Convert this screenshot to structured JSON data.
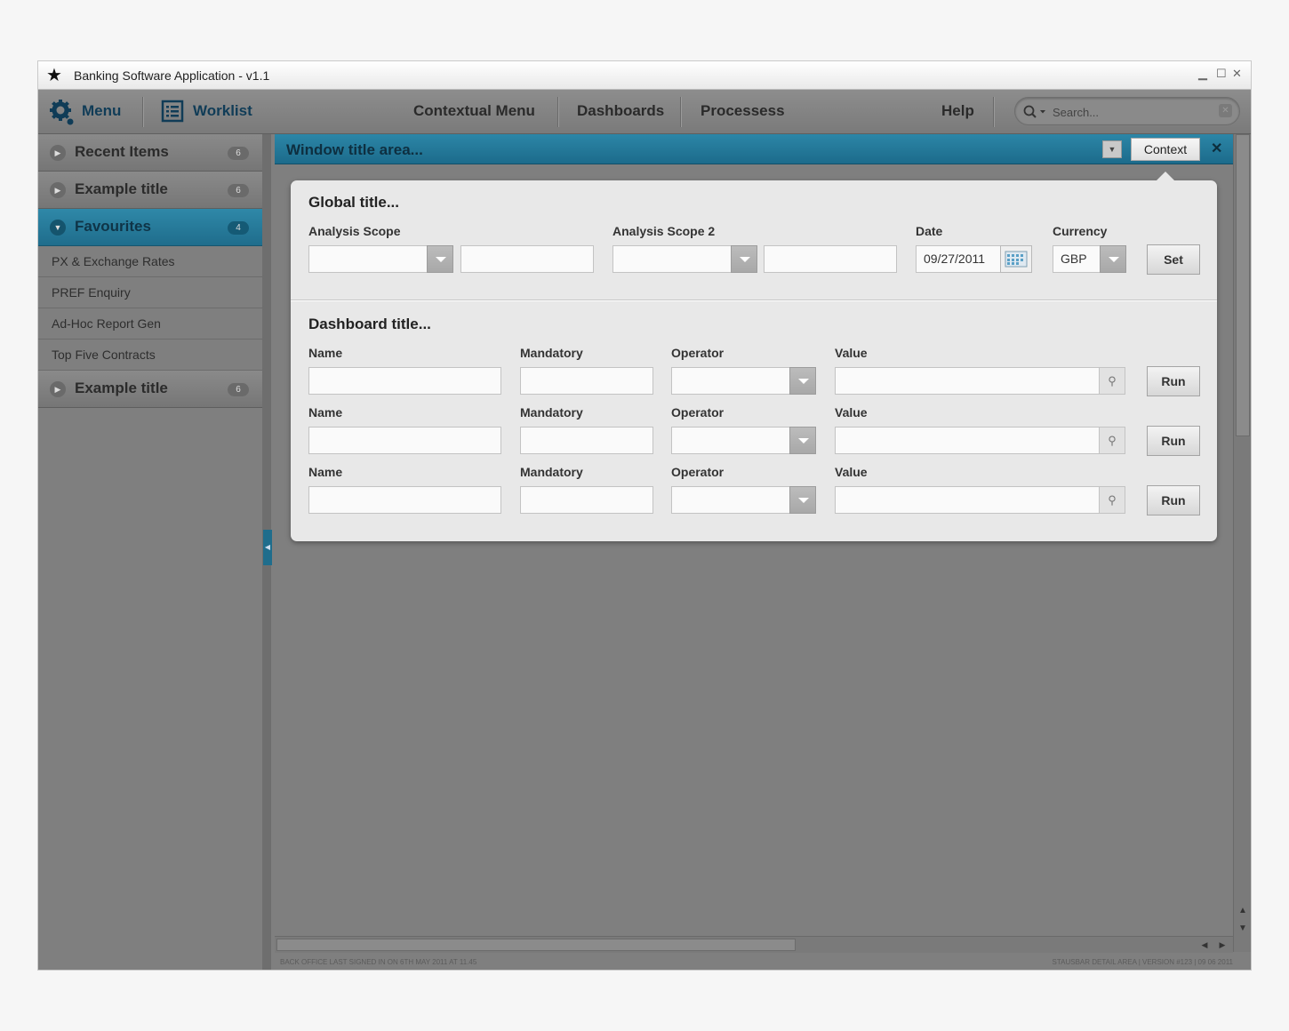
{
  "window": {
    "title": "Banking Software Application - v1.1"
  },
  "nav": {
    "menu": "Menu",
    "worklist": "Worklist",
    "contextual_menu": "Contextual Menu",
    "dashboards": "Dashboards",
    "processes": "Processess",
    "help": "Help",
    "search_placeholder": "Search..."
  },
  "sidebar": {
    "sections": [
      {
        "label": "Recent Items",
        "badge": "6"
      },
      {
        "label": "Example title",
        "badge": "6"
      },
      {
        "label": "Favourites",
        "badge": "4"
      },
      {
        "label": "Example title",
        "badge": "6"
      }
    ],
    "favourites_items": [
      "PX & Exchange Rates",
      "PREF Enquiry",
      "Ad-Hoc Report Gen",
      "Top Five Contracts"
    ]
  },
  "main": {
    "window_title": "Window title area...",
    "context_button": "Context",
    "global": {
      "title": "Global title...",
      "analysis_scope_label": "Analysis Scope",
      "analysis_scope2_label": "Analysis Scope 2",
      "date_label": "Date",
      "date_value": "09/27/2011",
      "currency_label": "Currency",
      "currency_value": "GBP",
      "set_button": "Set"
    },
    "dashboard": {
      "title": "Dashboard title...",
      "rows": [
        {
          "name_label": "Name",
          "mandatory_label": "Mandatory",
          "operator_label": "Operator",
          "value_label": "Value",
          "run": "Run"
        },
        {
          "name_label": "Name",
          "mandatory_label": "Mandatory",
          "operator_label": "Operator",
          "value_label": "Value",
          "run": "Run"
        },
        {
          "name_label": "Name",
          "mandatory_label": "Mandatory",
          "operator_label": "Operator",
          "value_label": "Value",
          "run": "Run"
        }
      ]
    }
  },
  "status": {
    "left": "BACK OFFICE LAST SIGNED IN ON 6TH MAY 2011 AT 11.45",
    "right": "STAUSBAR DETAIL AREA | VERSION #123 | 09 06 2011"
  },
  "colors": {
    "accent": "#1f6d8c",
    "chrome": "#7f7f7f",
    "panel": "#e8e8e8"
  },
  "icons": [
    "star-icon",
    "gear-icon",
    "worklist-icon",
    "search-icon",
    "calendar-icon",
    "close-icon",
    "chevron-down-icon"
  ]
}
